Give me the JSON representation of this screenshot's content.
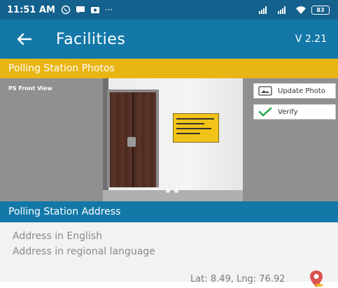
{
  "status_bar": {
    "time": "11:51 AM",
    "more": "···",
    "battery": "83"
  },
  "app_bar": {
    "title": "Facilities",
    "version": "V 2.21"
  },
  "photos_section": {
    "header": "Polling Station Photos",
    "photo_label": "PS Front View",
    "update_photo_label": "Update Photo",
    "verify_label": "Verify"
  },
  "address_section": {
    "header": "Polling Station Address",
    "address_english": "Address in English",
    "address_regional": "Address in regional language",
    "coordinates": "Lat: 8.49, Lng: 76.92"
  },
  "colors": {
    "status_bar": "#13618c",
    "app_bar": "#1378a8",
    "photos_header": "#e8b515",
    "verify_check": "#2fa84f",
    "map_pin": "#d9534f"
  },
  "icons": [
    "whatsapp-icon",
    "message-icon",
    "camera-icon",
    "signal-icon",
    "wifi-icon",
    "battery-icon",
    "back-arrow-icon",
    "photo-icon",
    "check-icon",
    "map-pin-icon"
  ]
}
